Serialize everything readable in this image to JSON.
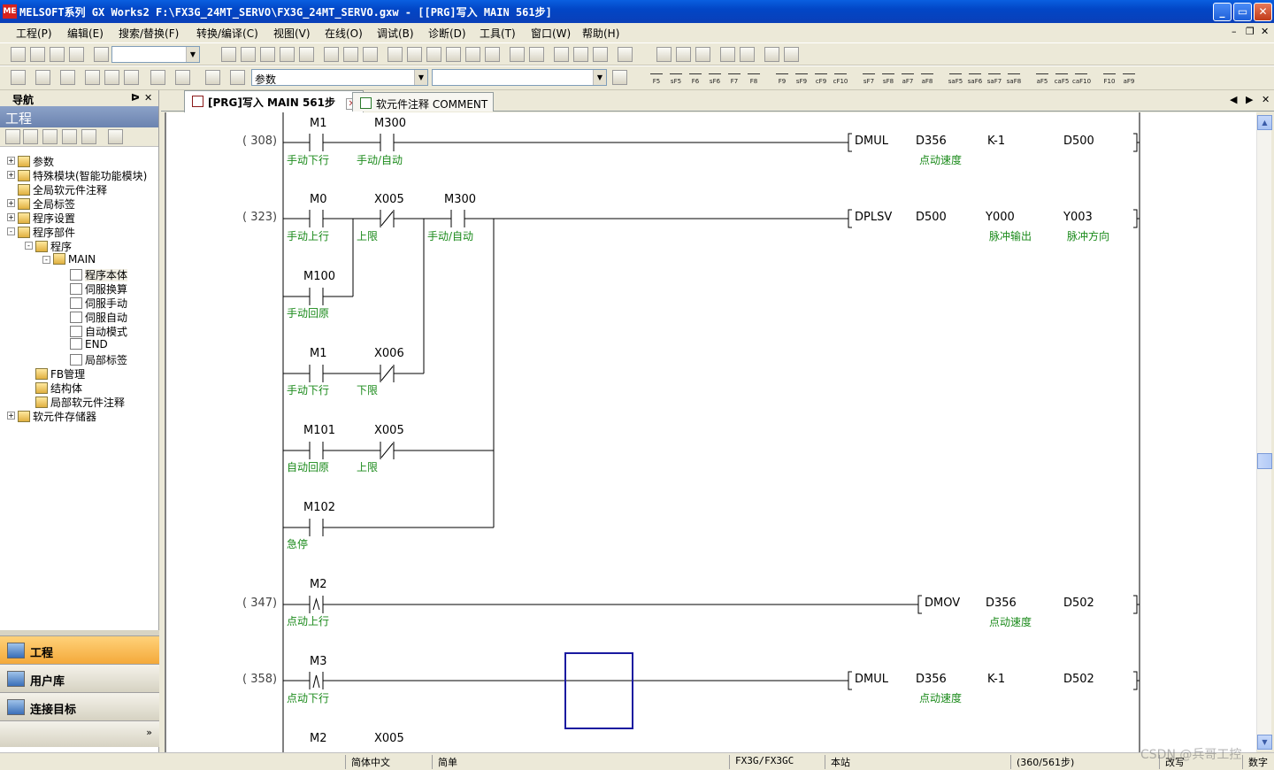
{
  "window": {
    "title": "MELSOFT系列 GX Works2 F:\\FX3G_24MT_SERVO\\FX3G_24MT_SERVO.gxw - [[PRG]写入 MAIN 561步]",
    "icon_text": "ME"
  },
  "menu": [
    "工程(P)",
    "编辑(E)",
    "搜索/替换(F)",
    "转换/编译(C)",
    "视图(V)",
    "在线(O)",
    "调试(B)",
    "诊断(D)",
    "工具(T)",
    "窗口(W)",
    "帮助(H)"
  ],
  "toolbar": {
    "combo_param": "参数",
    "fkeys": [
      "F5",
      "sF5",
      "F6",
      "sF6",
      "F7",
      "F8",
      "F9",
      "sF9",
      "cF9",
      "cF10",
      "sF7",
      "sF8",
      "aF7",
      "aF8",
      "saF5",
      "saF6",
      "saF7",
      "saF8",
      "aF5",
      "caF5",
      "caF10",
      "F10",
      "aF9"
    ]
  },
  "nav": {
    "header": "导航",
    "title": "工程",
    "tree": [
      {
        "label": "参数",
        "level": 0,
        "exp": "+"
      },
      {
        "label": "特殊模块(智能功能模块)",
        "level": 0,
        "exp": "+"
      },
      {
        "label": "全局软元件注释",
        "level": 0,
        "exp": ""
      },
      {
        "label": "全局标签",
        "level": 0,
        "exp": "+"
      },
      {
        "label": "程序设置",
        "level": 0,
        "exp": "+"
      },
      {
        "label": "程序部件",
        "level": 0,
        "exp": "-"
      },
      {
        "label": "程序",
        "level": 1,
        "exp": "-"
      },
      {
        "label": "MAIN",
        "level": 2,
        "exp": "-"
      },
      {
        "label": "程序本体",
        "level": 3,
        "exp": ""
      },
      {
        "label": "伺服换算",
        "level": 3,
        "exp": ""
      },
      {
        "label": "伺服手动",
        "level": 3,
        "exp": ""
      },
      {
        "label": "伺服自动",
        "level": 3,
        "exp": ""
      },
      {
        "label": "自动模式",
        "level": 3,
        "exp": ""
      },
      {
        "label": "END",
        "level": 3,
        "exp": ""
      },
      {
        "label": "局部标签",
        "level": 3,
        "exp": ""
      },
      {
        "label": "FB管理",
        "level": 1,
        "exp": ""
      },
      {
        "label": "结构体",
        "level": 1,
        "exp": ""
      },
      {
        "label": "局部软元件注释",
        "level": 1,
        "exp": ""
      },
      {
        "label": "软元件存储器",
        "level": 0,
        "exp": "+"
      }
    ],
    "sections": [
      "工程",
      "用户库",
      "连接目标"
    ]
  },
  "tabs": [
    {
      "label": "[PRG]写入 MAIN 561步",
      "active": true
    },
    {
      "label": "软元件注释 COMMENT",
      "active": false
    }
  ],
  "ladder": {
    "steps": [
      "( 308)",
      "( 323)",
      "( 347)",
      "( 358)"
    ],
    "contacts": [
      {
        "dev": "M1",
        "cmt": "手动下行"
      },
      {
        "dev": "M300",
        "cmt": "手动/自动"
      },
      {
        "dev": "M0",
        "cmt": "手动上行"
      },
      {
        "dev": "X005",
        "cmt": "上限"
      },
      {
        "dev": "M300",
        "cmt": "手动/自动"
      },
      {
        "dev": "M100",
        "cmt": "手动回原"
      },
      {
        "dev": "M1",
        "cmt": "手动下行"
      },
      {
        "dev": "X006",
        "cmt": "下限"
      },
      {
        "dev": "M101",
        "cmt": "自动回原"
      },
      {
        "dev": "X005",
        "cmt": "上限"
      },
      {
        "dev": "M102",
        "cmt": "急停"
      },
      {
        "dev": "M2",
        "cmt": "点动上行"
      },
      {
        "dev": "M3",
        "cmt": "点动下行"
      },
      {
        "dev": "M2",
        "cmt": ""
      },
      {
        "dev": "X005",
        "cmt": ""
      }
    ],
    "instructions": [
      {
        "op": "DMUL",
        "args": [
          "D356",
          "K-1",
          "D500"
        ],
        "cmts": [
          "点动速度",
          "",
          ""
        ]
      },
      {
        "op": "DPLSV",
        "args": [
          "D500",
          "Y000",
          "Y003"
        ],
        "cmts": [
          "",
          "脉冲输出",
          "脉冲方向"
        ]
      },
      {
        "op": "DMOV",
        "args": [
          "D356",
          "D502"
        ],
        "cmts": [
          "点动速度",
          ""
        ]
      },
      {
        "op": "DMUL",
        "args": [
          "D356",
          "K-1",
          "D502"
        ],
        "cmts": [
          "点动速度",
          "",
          ""
        ]
      }
    ]
  },
  "status": {
    "lang": "简体中文",
    "mode": "简单",
    "plc": "FX3G/FX3GC",
    "station": "本站",
    "steps": "(360/561步)",
    "edit": "改写",
    "num": "数字",
    "watermark": "CSDN @兵哥工控"
  },
  "colors": {
    "titlebar": "#0a5fe0",
    "comment": "#1a8a1a",
    "cursor": "#1a1aa0"
  }
}
